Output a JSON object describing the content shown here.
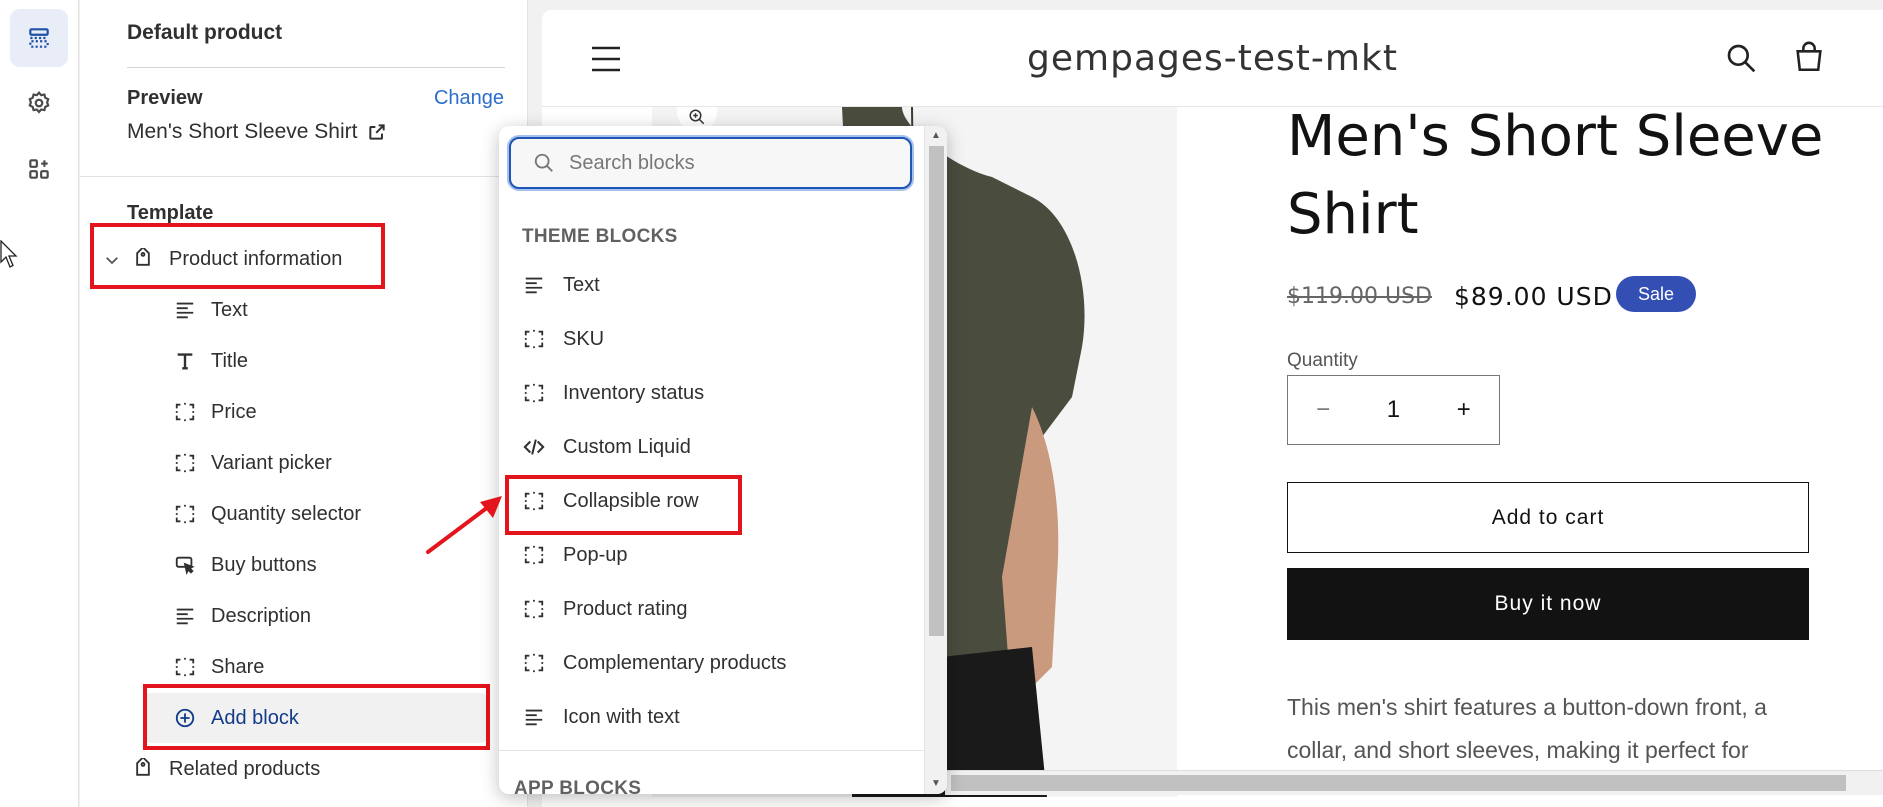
{
  "sidebar": {
    "title": "Default product",
    "preview_label": "Preview",
    "change_label": "Change",
    "preview_product": "Men's Short Sleeve Shirt",
    "template_label": "Template",
    "section_title": "Product information",
    "blocks": [
      {
        "label": "Text",
        "icon": "text-lines-icon"
      },
      {
        "label": "Title",
        "icon": "title-t-icon"
      },
      {
        "label": "Price",
        "icon": "dashed-square-icon"
      },
      {
        "label": "Variant picker",
        "icon": "dashed-square-icon"
      },
      {
        "label": "Quantity selector",
        "icon": "dashed-square-icon"
      },
      {
        "label": "Buy buttons",
        "icon": "cursor-click-icon"
      },
      {
        "label": "Description",
        "icon": "text-lines-icon"
      },
      {
        "label": "Share",
        "icon": "dashed-square-icon"
      }
    ],
    "add_block_label": "Add block",
    "related_label": "Related products"
  },
  "popover": {
    "search_placeholder": "Search blocks",
    "theme_blocks_label": "THEME BLOCKS",
    "app_blocks_label": "APP BLOCKS",
    "items": [
      {
        "label": "Text",
        "icon": "text-lines-icon"
      },
      {
        "label": "SKU",
        "icon": "dashed-square-icon"
      },
      {
        "label": "Inventory status",
        "icon": "dashed-square-icon"
      },
      {
        "label": "Custom Liquid",
        "icon": "code-icon"
      },
      {
        "label": "Collapsible row",
        "icon": "dashed-square-icon"
      },
      {
        "label": "Pop-up",
        "icon": "dashed-square-icon"
      },
      {
        "label": "Product rating",
        "icon": "dashed-square-icon"
      },
      {
        "label": "Complementary products",
        "icon": "dashed-square-icon"
      },
      {
        "label": "Icon with text",
        "icon": "text-lines-icon"
      }
    ]
  },
  "storefront": {
    "shop_name": "gempages-test-mkt",
    "product_title": "Men's Short Sleeve Shirt",
    "old_price": "$119.00 USD",
    "new_price": "$89.00 USD",
    "sale_badge": "Sale",
    "quantity_label": "Quantity",
    "quantity_value": "1",
    "minus": "−",
    "plus": "+",
    "add_to_cart": "Add to cart",
    "buy_now": "Buy it now",
    "description": "This men's shirt features a button-down front, a collar, and short sleeves, making it perfect for"
  },
  "colors": {
    "annotation_red": "#e3141b",
    "accent_blue": "#2c6ecb",
    "sale_badge": "#334fb4",
    "shirt": "#4a4d3e"
  }
}
